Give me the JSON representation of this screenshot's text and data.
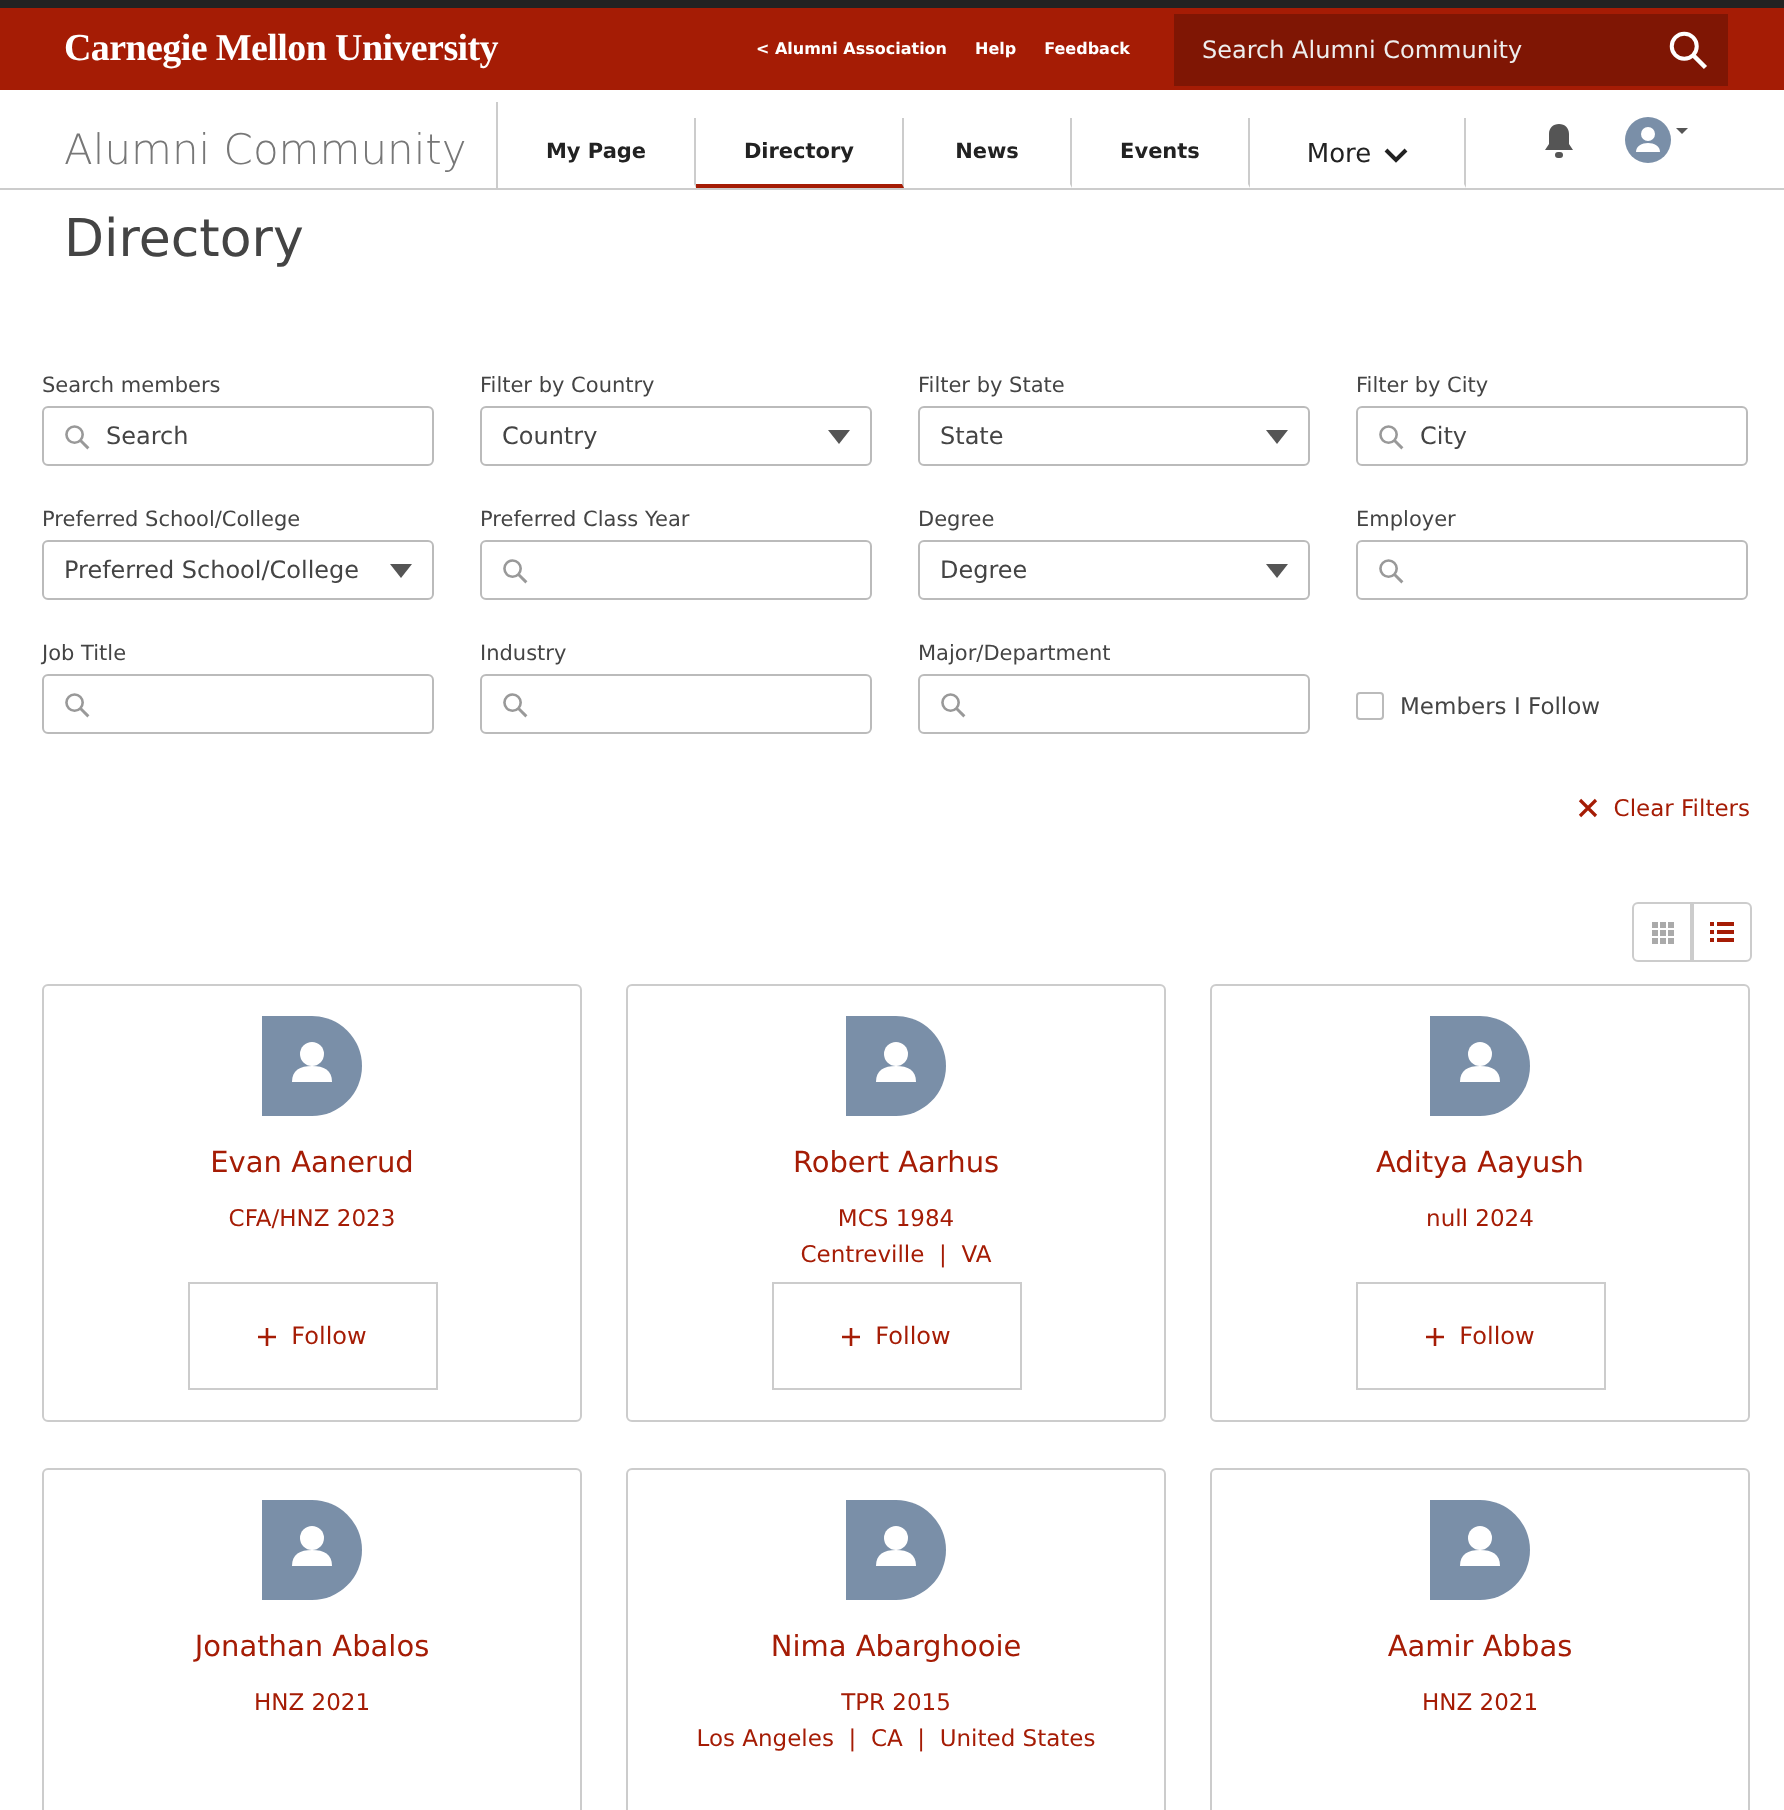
{
  "header": {
    "logo": "Carnegie Mellon University",
    "links": [
      "< Alumni Association",
      "Help",
      "Feedback"
    ],
    "search": {
      "placeholder": "Search Alumni Community"
    }
  },
  "nav": {
    "site_title": "Alumni Community",
    "tabs": [
      {
        "label": "My Page",
        "selected": false
      },
      {
        "label": "Directory",
        "selected": true
      },
      {
        "label": "News",
        "selected": false
      },
      {
        "label": "Events",
        "selected": false
      },
      {
        "label": "More",
        "selected": false,
        "kind": "menu"
      }
    ]
  },
  "page_title": "Directory",
  "filters": [
    {
      "kind": "search",
      "label": "Search members",
      "placeholder": "Search"
    },
    {
      "kind": "select",
      "label": "Filter by Country",
      "value": "Country"
    },
    {
      "kind": "select",
      "label": "Filter by State",
      "value": "State"
    },
    {
      "kind": "search",
      "label": "Filter by City",
      "placeholder": "City"
    },
    {
      "kind": "select",
      "label": "Preferred School/College",
      "value": "Preferred School/College"
    },
    {
      "kind": "search",
      "label": "Preferred Class Year"
    },
    {
      "kind": "select",
      "label": "Degree",
      "value": "Degree"
    },
    {
      "kind": "search",
      "label": "Employer"
    },
    {
      "kind": "search",
      "label": "Job Title"
    },
    {
      "kind": "search",
      "label": "Industry"
    },
    {
      "kind": "search",
      "label": "Major/Department"
    },
    {
      "kind": "checkbox",
      "label": "Members I Follow",
      "checked": false
    }
  ],
  "clear_filters": "Clear Filters",
  "view_toggle": [
    {
      "kind": "grid",
      "selected": false
    },
    {
      "kind": "list",
      "selected": true
    }
  ],
  "members": [
    {
      "name": "Evan Aanerud",
      "lines": [
        "CFA/HNZ 2023"
      ],
      "follow": "Follow"
    },
    {
      "name": "Robert Aarhus",
      "lines": [
        "MCS 1984",
        "Centreville  |  VA"
      ],
      "follow": "Follow"
    },
    {
      "name": "Aditya Aayush",
      "lines": [
        "null 2024"
      ],
      "follow": "Follow"
    },
    {
      "name": "Jonathan Abalos",
      "lines": [
        "HNZ 2021"
      ]
    },
    {
      "name": "Nima Abarghooie",
      "lines": [
        "TPR 2015",
        "Los Angeles  |  CA  |  United States"
      ]
    },
    {
      "name": "Aamir Abbas",
      "lines": [
        "HNZ 2021"
      ]
    }
  ]
}
